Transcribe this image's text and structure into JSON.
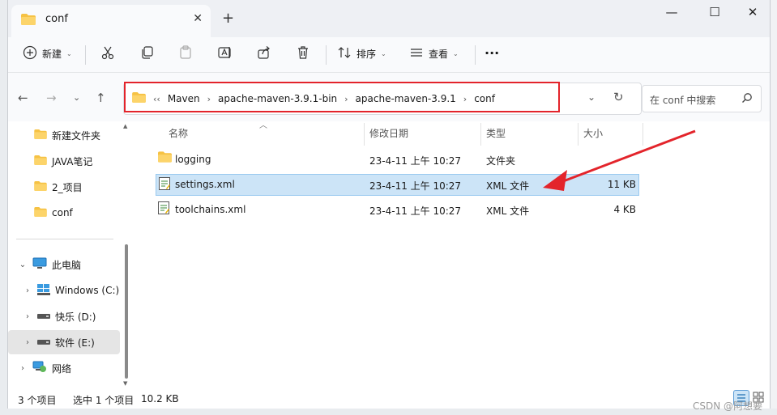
{
  "window": {
    "tab_title": "conf",
    "close_tab": "✕",
    "new_tab": "+",
    "minimize": "—",
    "maximize": "☐",
    "close": "✕"
  },
  "toolbar": {
    "new_label": "新建",
    "sort_label": "排序",
    "view_label": "查看",
    "more": "···"
  },
  "nav": {
    "breadcrumb_prefix": "‹‹",
    "breadcrumbs": [
      "Maven",
      "apache-maven-3.9.1-bin",
      "apache-maven-3.9.1",
      "conf"
    ],
    "crumb_sep": "›",
    "search_placeholder": "在 conf 中搜索"
  },
  "sidebar": {
    "quick": [
      {
        "label": "新建文件夹"
      },
      {
        "label": "JAVA笔记"
      },
      {
        "label": "2_项目"
      },
      {
        "label": "conf"
      }
    ],
    "this_pc": "此电脑",
    "drives": [
      {
        "label": "Windows (C:)"
      },
      {
        "label": "快乐 (D:)"
      },
      {
        "label": "软件 (E:)"
      }
    ],
    "network": "网络"
  },
  "columns": {
    "name": "名称",
    "date": "修改日期",
    "type": "类型",
    "size": "大小"
  },
  "files": [
    {
      "name": "logging",
      "date": "23-4-11 上午 10:27",
      "type": "文件夹",
      "size": "",
      "kind": "folder"
    },
    {
      "name": "settings.xml",
      "date": "23-4-11 上午 10:27",
      "type": "XML 文件",
      "size": "11 KB",
      "kind": "xml"
    },
    {
      "name": "toolchains.xml",
      "date": "23-4-11 上午 10:27",
      "type": "XML 文件",
      "size": "4 KB",
      "kind": "xml"
    }
  ],
  "status": {
    "count": "3 个项目",
    "selected": "选中 1 个项目",
    "size": "10.2 KB",
    "watermark": "CSDN @阿想要"
  },
  "colors": {
    "annotation_red": "#e3242b",
    "selection": "#cce4f7",
    "folder": "#f6c244"
  }
}
